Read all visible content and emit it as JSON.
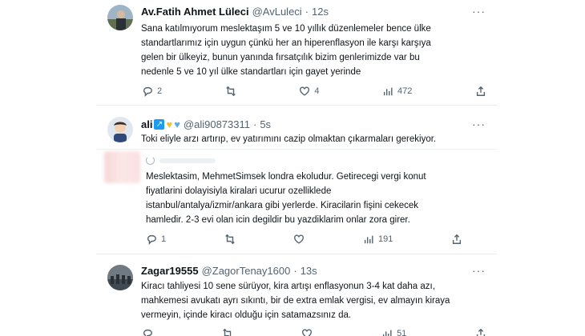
{
  "tweets": [
    {
      "name": "Av.Fatih Ahmet Lüleci",
      "handle": "@AvLuleci",
      "time": "12s",
      "lines": [
        "Sana katılmıyorum meslektaşım 5 ve 10 yıllık düzenlemeler bence ülke",
        "standartlarımız için uygun çünkü her an hiperenflasyon ile karşı karşıya",
        "gelen bir ülkeyiz, bunun yanında fırsatçılık bizim genlerimizde var bu",
        "nedenle 5 ve 10 yıl ülke standartları için gayet yerinde"
      ],
      "replies": "2",
      "retweets": "",
      "likes": "4",
      "views": "472"
    },
    {
      "name": "ali",
      "handle": "@ali90873311",
      "time": "5s",
      "lines": [
        "Toki eliyle arzı artırıp, ev yatırımını cazip olmaktan çıkarmaları gerekiyor."
      ]
    },
    {
      "lines": [
        "Meslektasim, MehmetSimsek londra ekoludur. Getirecegi vergi konut",
        "fiyatlarini dolayisiyla kiralari ucurur ozellikledе",
        "istanbul/antalya/izmir/ankara gibi yerlerde. Kiracilarin fişini cekecek",
        "hamledir. 2-3 evi olan icin degildir bu yazdiklarim onlar zora girer."
      ],
      "replies": "1",
      "retweets": "",
      "likes": "",
      "views": "191"
    },
    {
      "name": "Zagar19555",
      "handle": "@ZagorTenay1600",
      "time": "13s",
      "lines": [
        "Kiracı tahliyesi 10 sene sürüyor, kira artışı enflasyonun 3-4 kat daha azı,",
        "mahkemesi avukatı ayrı sıkıntı, bir de extra emlak vergisi, ev almayın kiraya",
        "vermeyin, içinde kiracı olduğu için satamazsınız da."
      ],
      "replies": "",
      "retweets": "",
      "likes": "",
      "views": "51"
    }
  ],
  "more_glyph": "···",
  "icons": [
    "reply-icon",
    "retweet-icon",
    "like-icon",
    "views-icon",
    "share-icon",
    "more-icon"
  ],
  "colors": {
    "accent": "#1d9bf0",
    "muted": "#536471",
    "text": "#0f1419"
  }
}
